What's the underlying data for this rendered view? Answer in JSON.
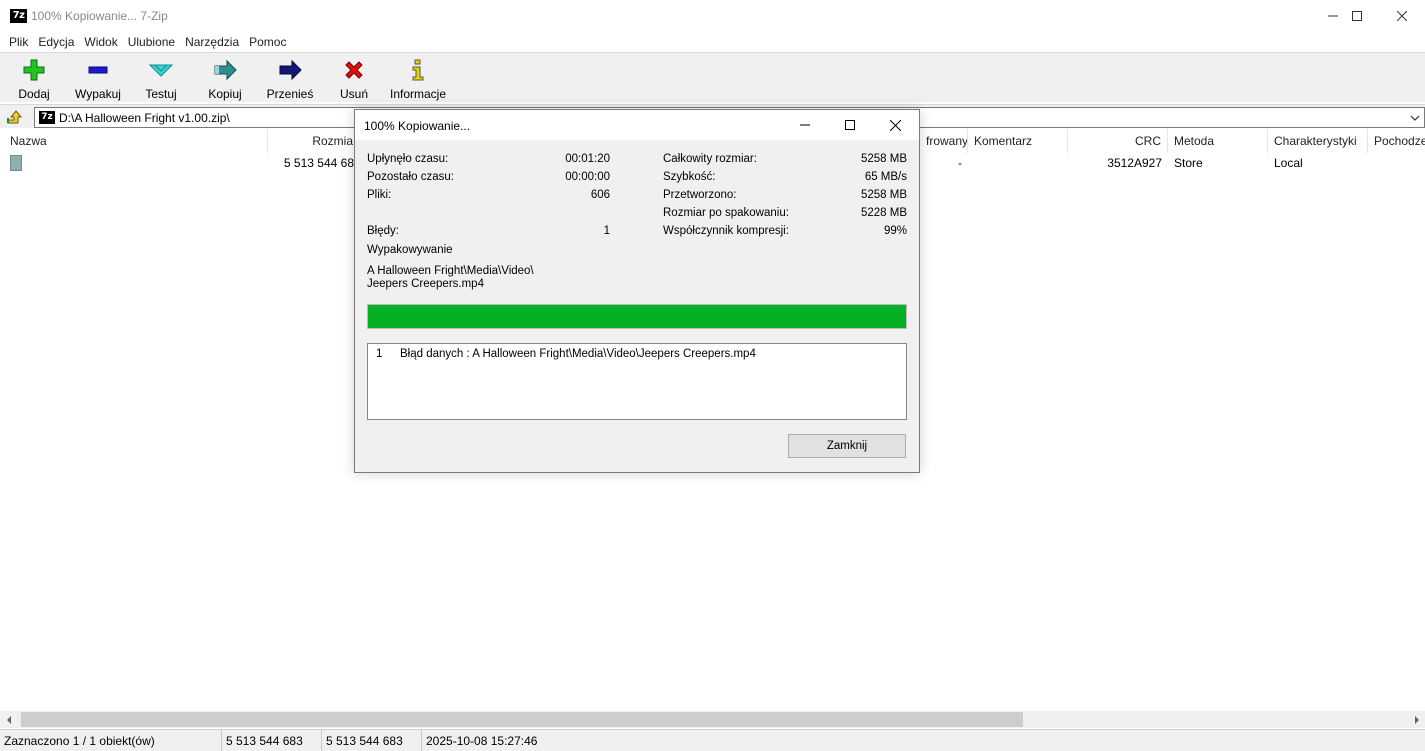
{
  "window": {
    "app_icon_text": "7z",
    "title": "100% Kopiowanie... 7-Zip"
  },
  "menu": [
    "Plik",
    "Edycja",
    "Widok",
    "Ulubione",
    "Narzędzia",
    "Pomoc"
  ],
  "toolbar": {
    "add": "Dodaj",
    "extract": "Wypakuj",
    "test": "Testuj",
    "copy": "Kopiuj",
    "move": "Przenieś",
    "delete": "Usuń",
    "info": "Informacje"
  },
  "address": {
    "icon_text": "7z",
    "path": "D:\\A Halloween Fright v1.00.zip\\"
  },
  "columns": {
    "name": "Nazwa",
    "size": "Rozmia",
    "encrypted": "frowany",
    "comment": "Komentarz",
    "crc": "CRC",
    "method": "Metoda",
    "characteristics": "Charakterystyki",
    "origin": "Pochodze"
  },
  "row": {
    "size": "5 513 544 68",
    "encrypted": "-",
    "crc": "3512A927",
    "method": "Store",
    "characteristics": "Local"
  },
  "status": {
    "selected": "Zaznaczono 1 / 1 obiekt(ów)",
    "size1": "5 513 544 683",
    "size2": "5 513 544 683",
    "datetime": "2025-10-08 15:27:46"
  },
  "dialog": {
    "title": "100% Kopiowanie...",
    "elapsed_label": "Upłynęło czasu:",
    "elapsed_value": "00:01:20",
    "remaining_label": "Pozostało czasu:",
    "remaining_value": "00:00:00",
    "files_label": "Pliki:",
    "files_value": "606",
    "errors_label": "Błędy:",
    "errors_value": "1",
    "total_size_label": "Całkowity rozmiar:",
    "total_size_value": "5258 MB",
    "speed_label": "Szybkość:",
    "speed_value": "65 MB/s",
    "processed_label": "Przetworzono:",
    "processed_value": "5258 MB",
    "packed_size_label": "Rozmiar po spakowaniu:",
    "packed_size_value": "5228 MB",
    "ratio_label": "Współczynnik kompresji:",
    "ratio_value": "99%",
    "operation": "Wypakowywanie",
    "current_path": "A Halloween Fright\\Media\\Video\\",
    "current_file": "Jeepers Creepers.mp4",
    "progress_percent": 100,
    "errors": [
      {
        "num": "1",
        "text": "Błąd danych : A Halloween Fright\\Media\\Video\\Jeepers Creepers.mp4"
      }
    ],
    "close_label": "Zamknij"
  },
  "colors": {
    "progress_fill": "#06b025",
    "dialog_bg": "#f0f0f0",
    "toolbar_bg": "#f0f0f0"
  }
}
